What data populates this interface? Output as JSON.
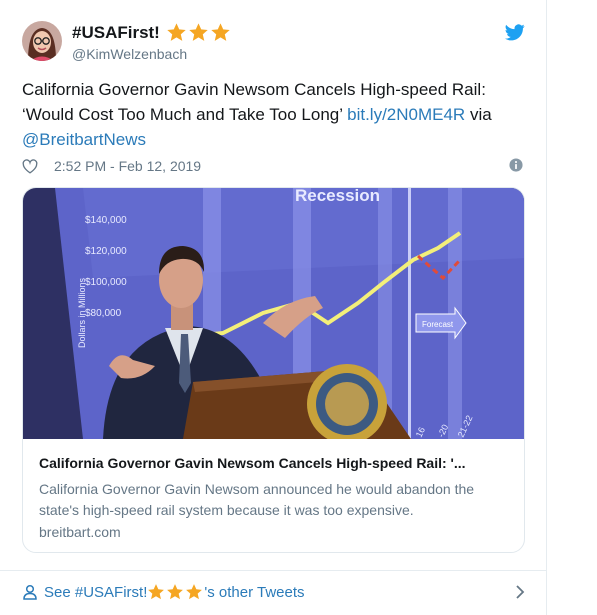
{
  "author": {
    "display_name": "#USAFirst!",
    "username": "@KimWelzenbach",
    "star_count": 3,
    "star_color": "#f5a623",
    "avatar_icon": "avatar-woman-glasses"
  },
  "brand": {
    "icon": "twitter-bird-icon",
    "color": "#1da1f2"
  },
  "tweet": {
    "text": "California Governor Gavin Newsom Cancels High-speed Rail: ‘Would Cost Too Much and Take Too Long’ ",
    "link": "bit.ly/2N0ME4R",
    "via": " via ",
    "mention": "@BreitbartNews",
    "timestamp": "2:52 PM - Feb 12, 2019",
    "link_color": "#2b7bb9"
  },
  "card": {
    "title": "California Governor Gavin Newsom Cancels High-speed Rail: '...",
    "description": "California Governor Gavin Newsom announced he would abandon the state's high-speed rail system because it was too expensive.",
    "domain": "breitbart.com",
    "image": {
      "slide_title": "Recession",
      "y_ticks": [
        "$140,000",
        "$120,000",
        "$100,000",
        "$80,000"
      ],
      "y_axis_label": "Dollars in Millions",
      "forecast_label": "Forecast",
      "x_ticks": [
        "16",
        "-20",
        "21-22"
      ]
    }
  },
  "footer": {
    "label_prefix": "See #USAFirst! ",
    "label_suffix": "'s other Tweets"
  }
}
